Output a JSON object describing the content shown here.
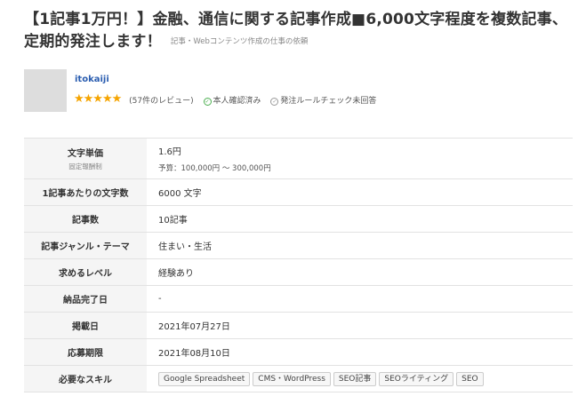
{
  "job": {
    "title": "【1記事1万円！】金融、通信に関する記事作成■6,000文字程度を複数記事、定期的発注します！",
    "category": "記事・Webコンテンツ作成の仕事の依頼"
  },
  "client": {
    "name": "itokaiji",
    "rating_stars": 5,
    "stars_text": "★★★★★",
    "reviews": "(57件のレビュー)",
    "identity_verified": "本人確認済み",
    "rule_check": "発注ルールチェック未回答"
  },
  "details": {
    "price_label": "文字単価",
    "price_sub": "固定報酬制",
    "price_value": "1.6円",
    "budget": "予算：100,000円 〜 300,000円",
    "chars_label": "1記事あたりの文字数",
    "chars_value": "6000 文字",
    "count_label": "記事数",
    "count_value": "10記事",
    "genre_label": "記事ジャンル・テーマ",
    "genre_value": "住まい・生活",
    "level_label": "求めるレベル",
    "level_value": "経験あり",
    "deadline_label": "納品完了日",
    "deadline_value": "-",
    "posted_label": "掲載日",
    "posted_value": "2021年07月27日",
    "apply_label": "応募期限",
    "apply_value": "2021年08月10日",
    "skills_label": "必要なスキル",
    "skills": [
      "Google Spreadsheet",
      "CMS・WordPress",
      "SEO記事",
      "SEOライティング",
      "SEO"
    ]
  },
  "colors": {
    "link": "#2a5db0",
    "star": "#f5a400",
    "verified": "#4caf50",
    "label_bg": "#f5f5f5"
  }
}
